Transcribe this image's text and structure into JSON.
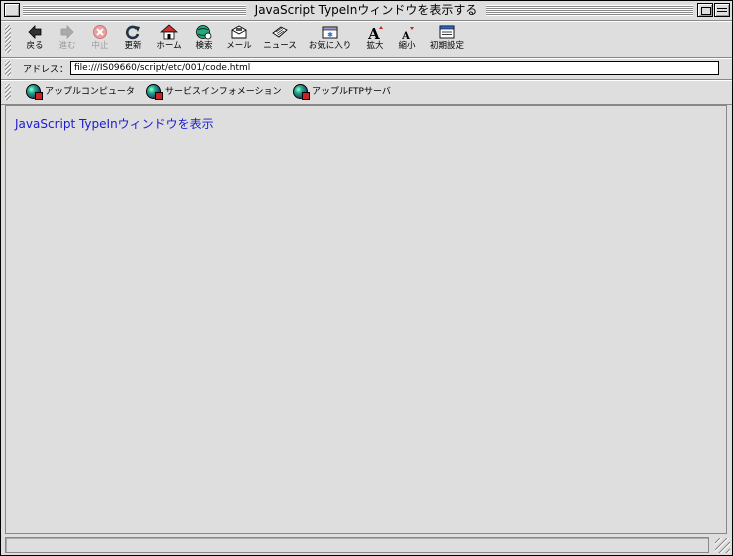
{
  "window": {
    "title": "JavaScript TypeInウィンドウを表示する"
  },
  "toolbar": {
    "buttons": [
      {
        "label": "戻る",
        "icon": "back-arrow-icon",
        "enabled": true
      },
      {
        "label": "進む",
        "icon": "forward-arrow-icon",
        "enabled": false
      },
      {
        "label": "中止",
        "icon": "stop-icon",
        "enabled": false
      },
      {
        "label": "更新",
        "icon": "refresh-icon",
        "enabled": true
      },
      {
        "label": "ホーム",
        "icon": "home-icon",
        "enabled": true
      },
      {
        "label": "検索",
        "icon": "search-globe-icon",
        "enabled": true
      },
      {
        "label": "メール",
        "icon": "mail-icon",
        "enabled": true
      },
      {
        "label": "ニュース",
        "icon": "news-icon",
        "enabled": true
      },
      {
        "label": "お気に入り",
        "icon": "favorites-icon",
        "enabled": true
      },
      {
        "label": "拡大",
        "icon": "enlarge-text-icon",
        "enabled": true
      },
      {
        "label": "縮小",
        "icon": "shrink-text-icon",
        "enabled": true
      },
      {
        "label": "初期設定",
        "icon": "preferences-icon",
        "enabled": true
      }
    ]
  },
  "address": {
    "label": "アドレス：",
    "value": "file:///IS09660/script/etc/001/code.html"
  },
  "favorites": [
    {
      "label": "アップルコンピュータ",
      "icon": "globe-icon"
    },
    {
      "label": "サービスインフォメーション",
      "icon": "globe-icon"
    },
    {
      "label": "アップルFTPサーバ",
      "icon": "globe-icon"
    }
  ],
  "content": {
    "link_text": "JavaScript TypeInウィンドウを表示"
  },
  "colors": {
    "link": "#1a1ad0",
    "chrome": "#dedede"
  }
}
